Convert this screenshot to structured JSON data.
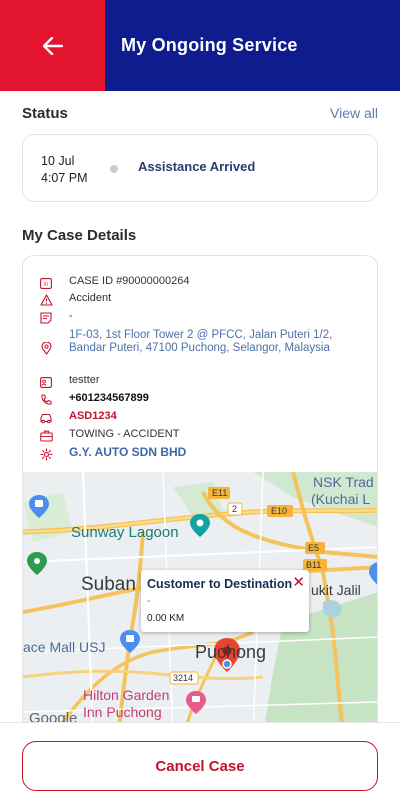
{
  "header": {
    "title": "My Ongoing Service",
    "back_icon": "arrow-left-icon",
    "left_color": "#e3142d",
    "right_color": "#0e1c8e"
  },
  "status": {
    "section_title": "Status",
    "view_all_label": "View all",
    "date": "10 Jul",
    "time": "4:07 PM",
    "text": "Assistance Arrived"
  },
  "case": {
    "section_title": "My Case Details",
    "case_id": "CASE ID #90000000264",
    "type": "Accident",
    "remarks": "-",
    "address": "1F-03, 1st Floor Tower 2 @ PFCC, Jalan Puteri 1/2, Bandar Puteri, 47100 Puchong, Selangor, Malaysia",
    "name": "testter",
    "phone": "+601234567899",
    "plate": "ASD1234",
    "service": "TOWING - ACCIDENT",
    "company": "G.Y. AUTO SDN BHD"
  },
  "map": {
    "labels": {
      "nsk": "NSK Trad",
      "kuchai": "(Kuchai L",
      "e11": "E11",
      "two": "2",
      "e10": "E10",
      "sunway": "Sunway Lagoon",
      "e5": "E5",
      "b11": "B11",
      "subang": "Suban",
      "jalil": "ukit Jalil",
      "usj": "ace Mall USJ",
      "puchong": "Puchong",
      "r3214": "3214",
      "hilton1": "Hilton Garden",
      "hilton2": "Inn Puchong",
      "google": "Google"
    },
    "popup": {
      "title": "Customer to Destination",
      "subtitle": "-",
      "distance": "0.00 KM"
    }
  },
  "footer": {
    "cancel_label": "Cancel Case"
  }
}
